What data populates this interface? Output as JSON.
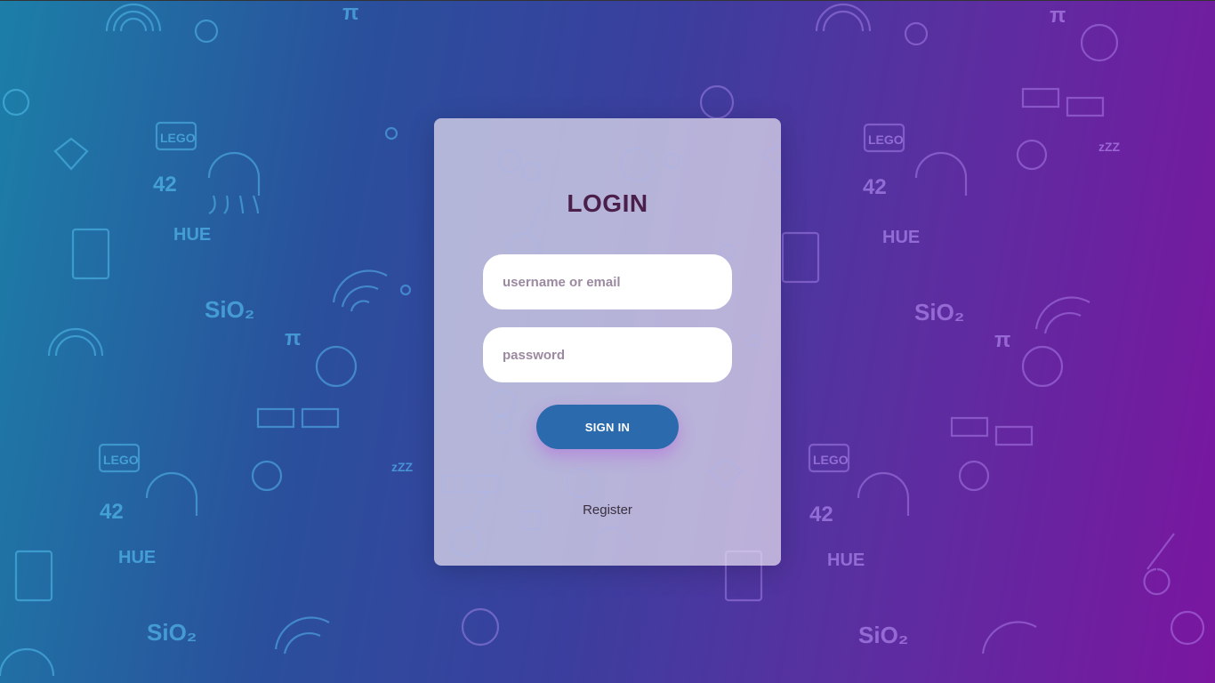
{
  "login": {
    "title": "LOGIN",
    "username_placeholder": "username or email",
    "password_placeholder": "password",
    "signin_label": "SIGN IN",
    "register_label": "Register"
  },
  "background": {
    "doodle_labels": [
      "HUE",
      "42",
      "SiO₂",
      "π",
      "LEGO",
      "zZZ"
    ]
  },
  "colors": {
    "gradient_left": "#1c7fa8",
    "gradient_right": "#7a16a0",
    "title": "#4a1f4a",
    "signin_button": "#2a6aad"
  }
}
